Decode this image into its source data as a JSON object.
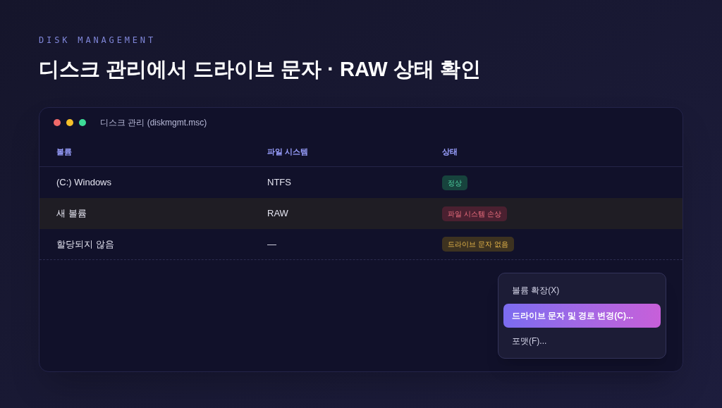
{
  "eyebrow": "DISK MANAGEMENT",
  "title": "디스크 관리에서 드라이브 문자 · RAW 상태 확인",
  "window": {
    "title": "디스크 관리 (diskmgmt.msc)"
  },
  "table": {
    "columns": [
      "볼륨",
      "파일 시스템",
      "상태"
    ],
    "rows": [
      {
        "volume": "(C:) Windows",
        "file_system": "NTFS",
        "status": {
          "text": "정상",
          "kind": "ok"
        },
        "selected": false
      },
      {
        "volume": "새 볼륨",
        "file_system": "RAW",
        "status": {
          "text": "파일 시스템 손상",
          "kind": "error"
        },
        "selected": true
      },
      {
        "volume": "할당되지 않음",
        "file_system": "—",
        "status": {
          "text": "드라이브 문자 없음",
          "kind": "warning"
        },
        "selected": false
      }
    ]
  },
  "context_menu": {
    "items": [
      {
        "label": "볼륨 확장(X)",
        "selected": false
      },
      {
        "label": "드라이브 문자 및 경로 변경(C)...",
        "selected": true
      },
      {
        "label": "포맷(F)...",
        "selected": false
      }
    ]
  }
}
